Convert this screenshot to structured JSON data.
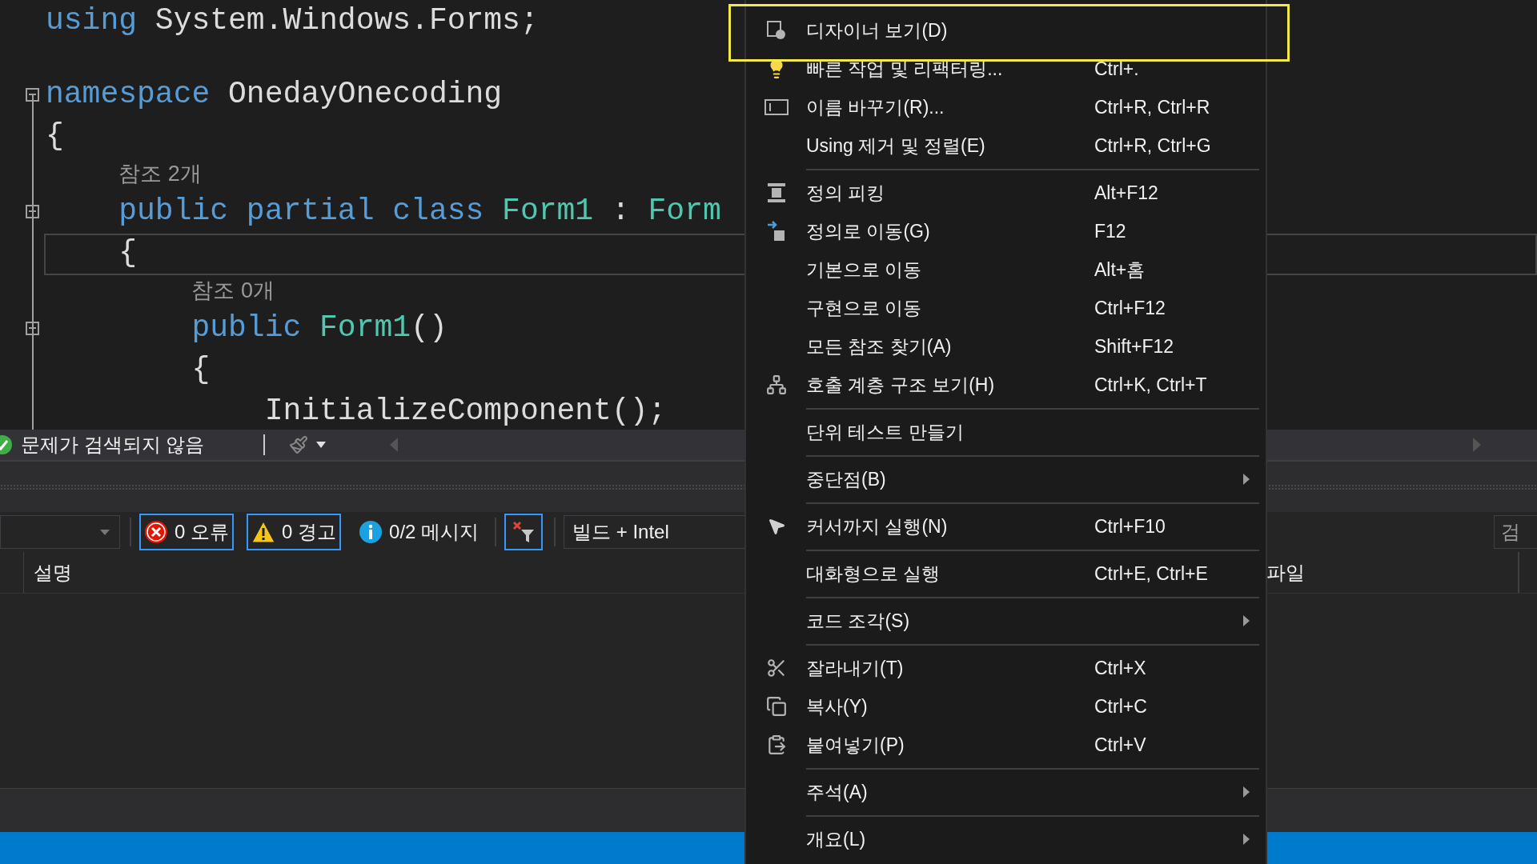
{
  "editor": {
    "lines": [
      {
        "kind": "code",
        "fold": false,
        "current": false,
        "tokens": [
          {
            "kind": "keyword",
            "text": "using"
          },
          {
            "kind": "plain",
            "text": " System.Windows.Forms;"
          }
        ]
      },
      {
        "kind": "blank"
      },
      {
        "kind": "code",
        "fold": true,
        "current": false,
        "tokens": [
          {
            "kind": "keyword",
            "text": "namespace"
          },
          {
            "kind": "plain",
            "text": " OnedayOnecoding"
          }
        ]
      },
      {
        "kind": "code",
        "fold": false,
        "current": false,
        "tokens": [
          {
            "kind": "plain",
            "text": "{"
          }
        ]
      },
      {
        "kind": "code",
        "fold": true,
        "current": false,
        "codelens": "참조 2개",
        "tokens": [
          {
            "kind": "keyword",
            "text": "    public partial class"
          },
          {
            "kind": "type",
            "text": " Form1"
          },
          {
            "kind": "plain",
            "text": " : "
          },
          {
            "kind": "type",
            "text": "Form"
          }
        ]
      },
      {
        "kind": "code",
        "fold": false,
        "current": true,
        "tokens": [
          {
            "kind": "plain",
            "text": "    {"
          }
        ]
      },
      {
        "kind": "code",
        "fold": true,
        "current": false,
        "codelens": "참조 0개",
        "tokens": [
          {
            "kind": "keyword",
            "text": "        public"
          },
          {
            "kind": "type",
            "text": " Form1"
          },
          {
            "kind": "plain",
            "text": "()"
          }
        ]
      },
      {
        "kind": "code",
        "fold": false,
        "current": false,
        "tokens": [
          {
            "kind": "plain",
            "text": "        {"
          }
        ]
      },
      {
        "kind": "code",
        "fold": false,
        "current": false,
        "tokens": [
          {
            "kind": "plain",
            "text": "            InitializeComponent();"
          }
        ]
      }
    ]
  },
  "editor_status": {
    "message": "문제가 검색되지 않음"
  },
  "error_list": {
    "filters": [
      {
        "kind": "error",
        "label": "0 오류",
        "selected": true
      },
      {
        "kind": "warning",
        "label": "0 경고",
        "selected": true
      },
      {
        "kind": "info",
        "label": "0/2 메시지",
        "selected": false
      }
    ],
    "filter_toggle": {
      "selected": true
    },
    "source": "빌드 + Intel",
    "search": {
      "placeholder": "검"
    },
    "columns": [
      {
        "label": "설명"
      },
      {
        "label": "파일"
      }
    ]
  },
  "context_menu": {
    "items": [
      {
        "kind": "item",
        "label": "디자이너 보기(D)",
        "submenu": false,
        "framed": true
      },
      {
        "kind": "item",
        "label": "빠른 작업 및 리팩터링...",
        "shortcut": "Ctrl+.",
        "submenu": false,
        "framed": false
      },
      {
        "kind": "item",
        "label": "이름 바꾸기(R)...",
        "shortcut": "Ctrl+R, Ctrl+R",
        "submenu": false,
        "framed": false
      },
      {
        "kind": "item",
        "label": "Using 제거 및 정렬(E)",
        "shortcut": "Ctrl+R, Ctrl+G",
        "submenu": false,
        "framed": false
      },
      {
        "kind": "separator"
      },
      {
        "kind": "item",
        "label": "정의 피킹",
        "shortcut": "Alt+F12",
        "submenu": false,
        "framed": false
      },
      {
        "kind": "item",
        "label": "정의로 이동(G)",
        "shortcut": "F12",
        "submenu": false,
        "framed": false
      },
      {
        "kind": "item",
        "label": "기본으로 이동",
        "shortcut": "Alt+홈",
        "submenu": false,
        "framed": false
      },
      {
        "kind": "item",
        "label": "구현으로 이동",
        "shortcut": "Ctrl+F12",
        "submenu": false,
        "framed": false
      },
      {
        "kind": "item",
        "label": "모든 참조 찾기(A)",
        "shortcut": "Shift+F12",
        "submenu": false,
        "framed": false
      },
      {
        "kind": "item",
        "label": "호출 계층 구조 보기(H)",
        "shortcut": "Ctrl+K, Ctrl+T",
        "submenu": false,
        "framed": false
      },
      {
        "kind": "separator"
      },
      {
        "kind": "item",
        "label": "단위 테스트 만들기",
        "submenu": false,
        "framed": false
      },
      {
        "kind": "separator"
      },
      {
        "kind": "item",
        "label": "중단점(B)",
        "submenu": true,
        "framed": false
      },
      {
        "kind": "separator"
      },
      {
        "kind": "item",
        "label": "커서까지 실행(N)",
        "shortcut": "Ctrl+F10",
        "submenu": false,
        "framed": false
      },
      {
        "kind": "separator"
      },
      {
        "kind": "item",
        "label": "대화형으로 실행",
        "shortcut": "Ctrl+E, Ctrl+E",
        "submenu": false,
        "framed": false
      },
      {
        "kind": "separator"
      },
      {
        "kind": "item",
        "label": "코드 조각(S)",
        "submenu": true,
        "framed": false
      },
      {
        "kind": "separator"
      },
      {
        "kind": "item",
        "label": "잘라내기(T)",
        "shortcut": "Ctrl+X",
        "submenu": false,
        "framed": false
      },
      {
        "kind": "item",
        "label": "복사(Y)",
        "shortcut": "Ctrl+C",
        "submenu": false,
        "framed": false
      },
      {
        "kind": "item",
        "label": "붙여넣기(P)",
        "shortcut": "Ctrl+V",
        "submenu": false,
        "framed": false
      },
      {
        "kind": "separator"
      },
      {
        "kind": "item",
        "label": "주석(A)",
        "submenu": true,
        "framed": false
      },
      {
        "kind": "separator"
      },
      {
        "kind": "item",
        "label": "개요(L)",
        "submenu": true,
        "framed": false
      }
    ]
  }
}
